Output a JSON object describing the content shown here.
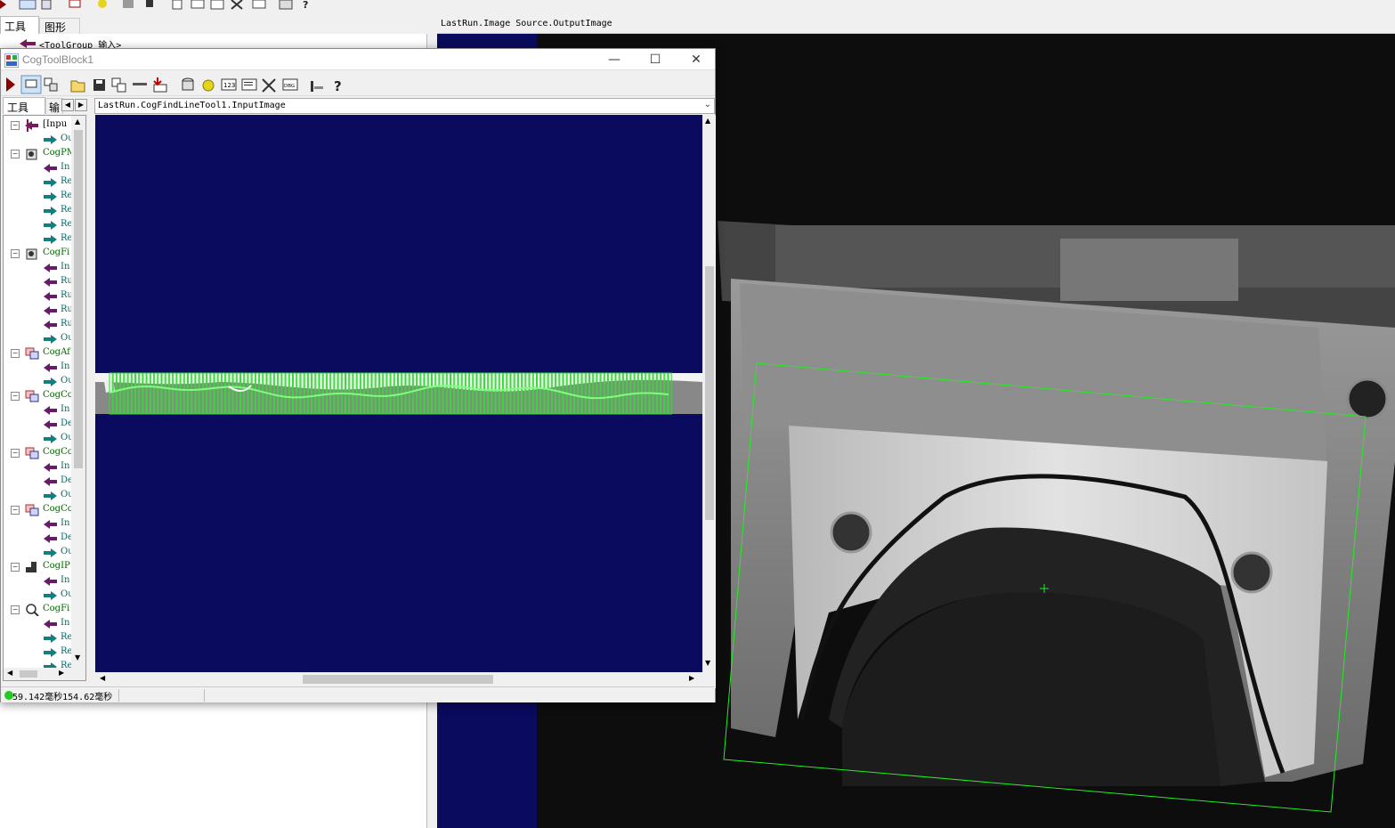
{
  "outer": {
    "tabs": [
      "工具",
      "图形"
    ],
    "tree_top_item": "<ToolGroup 输入>",
    "viewer_title": "LastRun.Image Source.OutputImage"
  },
  "dialog": {
    "title": "CogToolBlock1",
    "panel_tabs": [
      "工具",
      "输"
    ],
    "image_selector": "LastRun.CogFindLineTool1.InputImage",
    "status": "59.142毫秒154.62毫秒",
    "tree": [
      {
        "kind": "group",
        "label": "[Inpu",
        "icon": "input"
      },
      {
        "kind": "out",
        "label": "Ou"
      },
      {
        "kind": "group",
        "label": "CogPM",
        "icon": "pm"
      },
      {
        "kind": "in",
        "label": "In"
      },
      {
        "kind": "out",
        "label": "Re"
      },
      {
        "kind": "out",
        "label": "Re"
      },
      {
        "kind": "out",
        "label": "Re"
      },
      {
        "kind": "out",
        "label": "Re"
      },
      {
        "kind": "out",
        "label": "Re"
      },
      {
        "kind": "group",
        "label": "CogFi",
        "icon": "fixture"
      },
      {
        "kind": "in",
        "label": "In"
      },
      {
        "kind": "in",
        "label": "Ru"
      },
      {
        "kind": "in",
        "label": "Ru"
      },
      {
        "kind": "in",
        "label": "Ru"
      },
      {
        "kind": "in",
        "label": "Ru"
      },
      {
        "kind": "out",
        "label": "Ou"
      },
      {
        "kind": "group",
        "label": "CogAf",
        "icon": "affine"
      },
      {
        "kind": "in",
        "label": "In"
      },
      {
        "kind": "out",
        "label": "Ou"
      },
      {
        "kind": "group",
        "label": "CogCo",
        "icon": "copy"
      },
      {
        "kind": "in",
        "label": "In"
      },
      {
        "kind": "in",
        "label": "De"
      },
      {
        "kind": "out",
        "label": "Ou"
      },
      {
        "kind": "group",
        "label": "CogCo",
        "icon": "copy"
      },
      {
        "kind": "in",
        "label": "In"
      },
      {
        "kind": "in",
        "label": "De"
      },
      {
        "kind": "out",
        "label": "Ou"
      },
      {
        "kind": "group",
        "label": "CogCo",
        "icon": "copy"
      },
      {
        "kind": "in",
        "label": "In"
      },
      {
        "kind": "in",
        "label": "De"
      },
      {
        "kind": "out",
        "label": "Ou"
      },
      {
        "kind": "group",
        "label": "CogIP",
        "icon": "ip"
      },
      {
        "kind": "in",
        "label": "In"
      },
      {
        "kind": "out",
        "label": "Ou"
      },
      {
        "kind": "group",
        "label": "CogFi",
        "icon": "find"
      },
      {
        "kind": "in",
        "label": "In"
      },
      {
        "kind": "out",
        "label": "Re"
      },
      {
        "kind": "out",
        "label": "Re"
      },
      {
        "kind": "out",
        "label": "Re"
      }
    ]
  },
  "colors": {
    "navy": "#0a0a5e",
    "caliper_green": "#33dd33",
    "roi_green": "#22ee22",
    "status_dot": "#22cc22"
  },
  "icons": [
    "run-icon",
    "display-icon",
    "link-icon",
    "open-icon",
    "save-icon",
    "copy-icon",
    "dots-icon",
    "import-icon",
    "db-icon",
    "wand-icon",
    "numbers-icon",
    "terminal-icon",
    "tools-icon",
    "dbg-icon",
    "stats-icon",
    "help-icon"
  ]
}
